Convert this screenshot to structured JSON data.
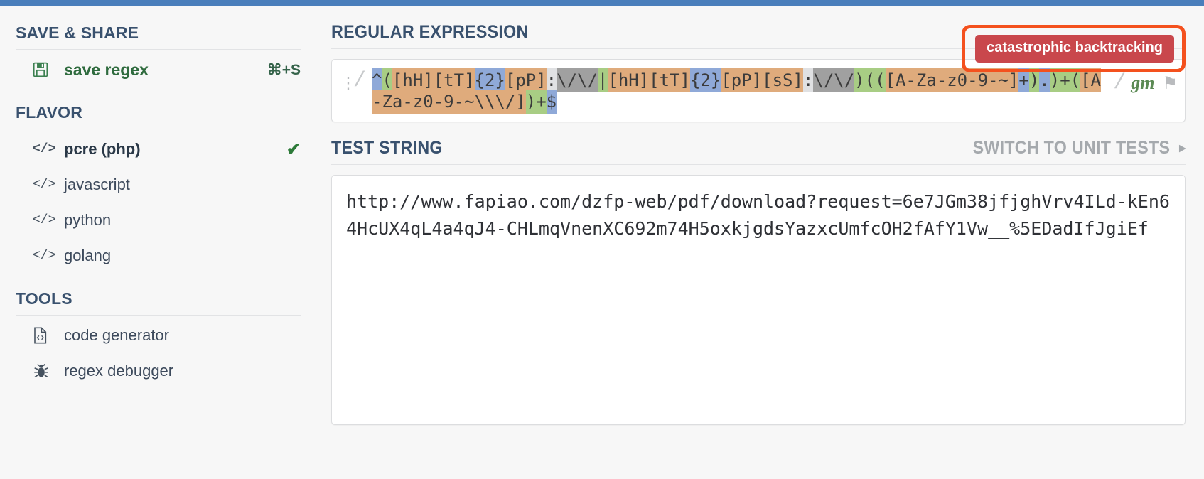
{
  "sidebar": {
    "sections": [
      {
        "title": "SAVE & SHARE",
        "items": [
          {
            "icon": "floppy-disk-icon",
            "label": "save regex",
            "shortcut": "⌘+S"
          }
        ]
      },
      {
        "title": "FLAVOR",
        "items": [
          {
            "icon": "code-icon",
            "label": "pcre (php)",
            "selected": true,
            "check": "✔"
          },
          {
            "icon": "code-icon",
            "label": "javascript",
            "selected": false
          },
          {
            "icon": "code-icon",
            "label": "python",
            "selected": false
          },
          {
            "icon": "code-icon",
            "label": "golang",
            "selected": false
          }
        ]
      },
      {
        "title": "TOOLS",
        "items": [
          {
            "icon": "code-file-icon",
            "label": "code generator"
          },
          {
            "icon": "bug-icon",
            "label": "regex debugger"
          }
        ]
      }
    ]
  },
  "main": {
    "regex_panel": {
      "title": "REGULAR EXPRESSION",
      "error_badge": "catastrophic backtracking",
      "open_slash": "/",
      "close_slash": "/",
      "flags": "gm",
      "flag_icon": "⚑",
      "drag_handle_icon": "⋮",
      "pattern": "^([hH][tT]{2}[pP]:\\/\\/|[hH][tT]{2}[pP][sS]:\\/\\/)(([A-Za-z0-9-~]+).)+([A-Za-z0-9-~\\\\\\/])+$",
      "tokens": [
        {
          "text": "^",
          "kind": "anchor"
        },
        {
          "text": "(",
          "kind": "group"
        },
        {
          "text": "[hH]",
          "kind": "class"
        },
        {
          "text": "[tT]",
          "kind": "class"
        },
        {
          "text": "{2}",
          "kind": "quant"
        },
        {
          "text": "[pP]",
          "kind": "class"
        },
        {
          "text": ":",
          "kind": "lit"
        },
        {
          "text": "\\/\\/",
          "kind": "esc"
        },
        {
          "text": "|",
          "kind": "group"
        },
        {
          "text": "[hH]",
          "kind": "class"
        },
        {
          "text": "[tT]",
          "kind": "class"
        },
        {
          "text": "{2}",
          "kind": "quant"
        },
        {
          "text": "[pP]",
          "kind": "class"
        },
        {
          "text": "[sS]",
          "kind": "class"
        },
        {
          "text": ":",
          "kind": "lit"
        },
        {
          "text": "\\/\\/",
          "kind": "esc"
        },
        {
          "text": ")",
          "kind": "group"
        },
        {
          "text": "(",
          "kind": "group"
        },
        {
          "text": "(",
          "kind": "group"
        },
        {
          "text": "[A-Za-z0-9-~]",
          "kind": "class"
        },
        {
          "text": "+",
          "kind": "quant"
        },
        {
          "text": ")",
          "kind": "group"
        },
        {
          "text": ".",
          "kind": "quant"
        },
        {
          "text": ")",
          "kind": "group"
        },
        {
          "text": "+",
          "kind": "group"
        },
        {
          "text": "(",
          "kind": "group"
        },
        {
          "text": "[A-Za-z0-9-~\\\\\\/]",
          "kind": "class"
        },
        {
          "text": ")",
          "kind": "group"
        },
        {
          "text": "+",
          "kind": "group"
        },
        {
          "text": "$",
          "kind": "anchor"
        }
      ]
    },
    "test_panel": {
      "title": "TEST STRING",
      "switch_label": "SWITCH TO UNIT TESTS",
      "switch_arrow": "▸",
      "content": "http://www.fapiao.com/dzfp-web/pdf/download?request=6e7JGm38jfjghVrv4ILd-kEn64HcUX4qL4a4qJ4-CHLmqVnenXC692m74H5oxkjgdsYazxcUmfcOH2fAfY1Vw__%5EDadIfJgiEf"
    }
  },
  "colors": {
    "accent_blue": "#4a7ebb",
    "heading_navy": "#39516e",
    "error_red": "#c9474c",
    "highlight_orange": "#f4511e",
    "save_green": "#2f6b3e"
  }
}
